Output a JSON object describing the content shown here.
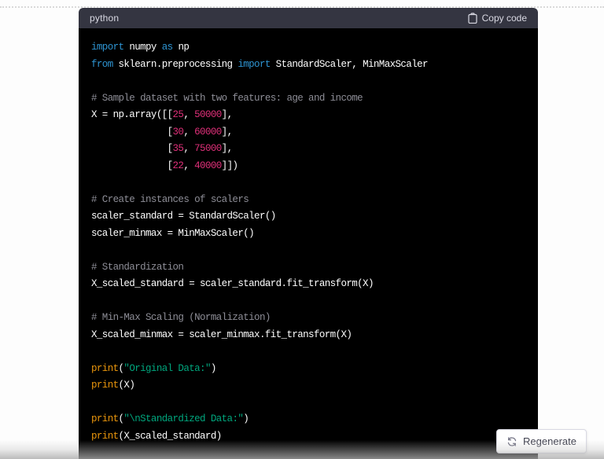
{
  "code_block": {
    "language_label": "python",
    "copy_button": {
      "label": "Copy code",
      "icon": "clipboard-icon"
    },
    "colors": {
      "header_bg": "#343541",
      "header_text": "#d9d9e3",
      "code_bg": "#000000",
      "keyword": "#2e95d3",
      "number": "#df3079",
      "comment": "#8e8e97",
      "builtin": "#e9950c",
      "string": "#00a67d",
      "plain": "#ffffff"
    },
    "lines": [
      [
        [
          "kw",
          "import"
        ],
        [
          "pl",
          " numpy "
        ],
        [
          "kw",
          "as"
        ],
        [
          "pl",
          " np"
        ]
      ],
      [
        [
          "kw",
          "from"
        ],
        [
          "pl",
          " sklearn.preprocessing "
        ],
        [
          "kw",
          "import"
        ],
        [
          "pl",
          " StandardScaler, MinMaxScaler"
        ]
      ],
      [],
      [
        [
          "com",
          "# Sample dataset with two features: age and income"
        ]
      ],
      [
        [
          "pl",
          "X = np.array([["
        ],
        [
          "num",
          "25"
        ],
        [
          "pl",
          ", "
        ],
        [
          "num",
          "50000"
        ],
        [
          "pl",
          "],"
        ]
      ],
      [
        [
          "pl",
          "              ["
        ],
        [
          "num",
          "30"
        ],
        [
          "pl",
          ", "
        ],
        [
          "num",
          "60000"
        ],
        [
          "pl",
          "],"
        ]
      ],
      [
        [
          "pl",
          "              ["
        ],
        [
          "num",
          "35"
        ],
        [
          "pl",
          ", "
        ],
        [
          "num",
          "75000"
        ],
        [
          "pl",
          "],"
        ]
      ],
      [
        [
          "pl",
          "              ["
        ],
        [
          "num",
          "22"
        ],
        [
          "pl",
          ", "
        ],
        [
          "num",
          "40000"
        ],
        [
          "pl",
          "]])"
        ]
      ],
      [],
      [
        [
          "com",
          "# Create instances of scalers"
        ]
      ],
      [
        [
          "pl",
          "scaler_standard = StandardScaler()"
        ]
      ],
      [
        [
          "pl",
          "scaler_minmax = MinMaxScaler()"
        ]
      ],
      [],
      [
        [
          "com",
          "# Standardization"
        ]
      ],
      [
        [
          "pl",
          "X_scaled_standard = scaler_standard.fit_transform(X)"
        ]
      ],
      [],
      [
        [
          "com",
          "# Min-Max Scaling (Normalization)"
        ]
      ],
      [
        [
          "pl",
          "X_scaled_minmax = scaler_minmax.fit_transform(X)"
        ]
      ],
      [],
      [
        [
          "bi",
          "print"
        ],
        [
          "pl",
          "("
        ],
        [
          "str",
          "\"Original Data:\""
        ],
        [
          "pl",
          ")"
        ]
      ],
      [
        [
          "bi",
          "print"
        ],
        [
          "pl",
          "(X)"
        ]
      ],
      [],
      [
        [
          "bi",
          "print"
        ],
        [
          "pl",
          "("
        ],
        [
          "str",
          "\"\\nStandardized Data:\""
        ],
        [
          "pl",
          ")"
        ]
      ],
      [
        [
          "bi",
          "print"
        ],
        [
          "pl",
          "(X_scaled_standard)"
        ]
      ]
    ]
  },
  "regenerate_button": {
    "label": "Regenerate",
    "icon": "regenerate-icon"
  }
}
